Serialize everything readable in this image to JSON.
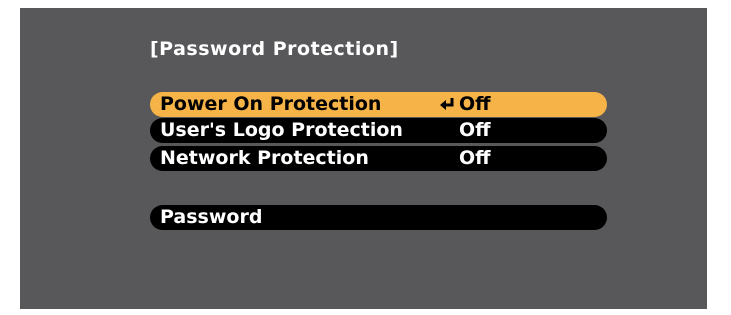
{
  "menu": {
    "title": "[Password Protection]",
    "items": [
      {
        "label": "Power On Protection",
        "value": "Off",
        "selected": true,
        "icon": "enter-icon"
      },
      {
        "label": "User's Logo Protection",
        "value": "Off",
        "selected": false
      },
      {
        "label": "Network Protection",
        "value": "Off",
        "selected": false
      },
      {
        "label": "Password",
        "value": "",
        "selected": false
      }
    ]
  },
  "colors": {
    "screen_background": "#58585a",
    "selected_row": "#f5b348",
    "row_background": "#000000",
    "text": "#ffffff",
    "selected_text": "#000000"
  }
}
